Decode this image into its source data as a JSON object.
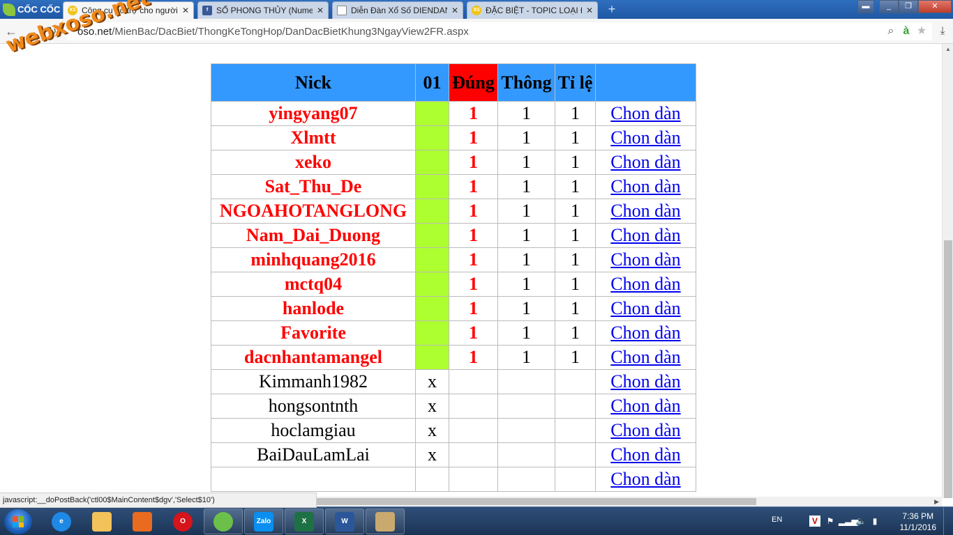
{
  "browser": {
    "brand": "CỐC CỐC",
    "tabs": [
      {
        "title": "Công cụ hỗ trợ cho người",
        "favicon": "xs-icon",
        "color": "#f0c419",
        "active": true
      },
      {
        "title": "SỐ PHONG THỦY (Numero",
        "favicon": "facebook-icon",
        "color": "#3b5998",
        "active": false
      },
      {
        "title": "Diễn Đàn Xổ Số DIENDAN",
        "favicon": "page-icon",
        "color": "#ffffff",
        "active": false
      },
      {
        "title": "ĐẶC BIỆT - TOPIC LOẠI ĐẶ",
        "favicon": "xs-icon",
        "color": "#f0c419",
        "active": false
      }
    ],
    "address": {
      "host": "oso.net",
      "path": "/MienBac/DacBiet/ThongKeTongHop/DanDacBietKhung3NgayView2FR.aspx"
    },
    "status_text": "javascript:__doPostBack('ctl00$MainContent$dgv','Select$10')"
  },
  "watermark": "webxoso.net",
  "table": {
    "headers": {
      "nick": "Nick",
      "col01": "01",
      "dung": "Đúng",
      "thong": "Thông",
      "tile": "Tỉ lệ",
      "action": ""
    },
    "action_label": "Chon dàn",
    "rows": [
      {
        "nick": "yingyang07",
        "hit": true,
        "col01": "",
        "dung": "1",
        "thong": "1",
        "tile": "1"
      },
      {
        "nick": "Xlmtt",
        "hit": true,
        "col01": "",
        "dung": "1",
        "thong": "1",
        "tile": "1"
      },
      {
        "nick": "xeko",
        "hit": true,
        "col01": "",
        "dung": "1",
        "thong": "1",
        "tile": "1"
      },
      {
        "nick": "Sat_Thu_De",
        "hit": true,
        "col01": "",
        "dung": "1",
        "thong": "1",
        "tile": "1"
      },
      {
        "nick": "NGOAHOTANGLONG",
        "hit": true,
        "col01": "",
        "dung": "1",
        "thong": "1",
        "tile": "1"
      },
      {
        "nick": "Nam_Dai_Duong",
        "hit": true,
        "col01": "",
        "dung": "1",
        "thong": "1",
        "tile": "1"
      },
      {
        "nick": "minhquang2016",
        "hit": true,
        "col01": "",
        "dung": "1",
        "thong": "1",
        "tile": "1"
      },
      {
        "nick": "mctq04",
        "hit": true,
        "col01": "",
        "dung": "1",
        "thong": "1",
        "tile": "1"
      },
      {
        "nick": "hanlode",
        "hit": true,
        "col01": "",
        "dung": "1",
        "thong": "1",
        "tile": "1"
      },
      {
        "nick": "Favorite",
        "hit": true,
        "col01": "",
        "dung": "1",
        "thong": "1",
        "tile": "1"
      },
      {
        "nick": "dacnhantamangel",
        "hit": true,
        "col01": "",
        "dung": "1",
        "thong": "1",
        "tile": "1"
      },
      {
        "nick": "Kimmanh1982",
        "hit": false,
        "col01": "x",
        "dung": "",
        "thong": "",
        "tile": ""
      },
      {
        "nick": "hongsontnth",
        "hit": false,
        "col01": "x",
        "dung": "",
        "thong": "",
        "tile": ""
      },
      {
        "nick": "hoclamgiau",
        "hit": false,
        "col01": "x",
        "dung": "",
        "thong": "",
        "tile": ""
      },
      {
        "nick": "BaiDauLamLai",
        "hit": false,
        "col01": "x",
        "dung": "",
        "thong": "",
        "tile": ""
      },
      {
        "nick": "",
        "hit": false,
        "col01": "",
        "dung": "",
        "thong": "",
        "tile": ""
      }
    ]
  },
  "colors": {
    "header_bg": "#3399ff",
    "dung_header_bg": "#ff0000",
    "hit_text": "#ff0000",
    "hit_cell": "#adff2f",
    "link": "#0000ee"
  },
  "taskbar": {
    "apps": [
      {
        "name": "internet-explorer-icon",
        "label": "e",
        "color": "#1e88e5"
      },
      {
        "name": "file-explorer-icon",
        "label": "",
        "color": "#f3c25a"
      },
      {
        "name": "media-player-icon",
        "label": "",
        "color": "#e86b1f"
      },
      {
        "name": "opera-icon",
        "label": "O",
        "color": "#d5141b"
      },
      {
        "name": "coccoc-icon",
        "label": "",
        "color": "#6cc04a"
      },
      {
        "name": "zalo-icon",
        "label": "Zalo",
        "color": "#0a8ff0"
      },
      {
        "name": "excel-icon",
        "label": "X",
        "color": "#1e7145"
      },
      {
        "name": "word-icon",
        "label": "W",
        "color": "#2b579a"
      },
      {
        "name": "paint-icon",
        "label": "",
        "color": "#c9a96e"
      }
    ],
    "language": "EN",
    "time": "7:36 PM",
    "date": "11/1/2016"
  }
}
